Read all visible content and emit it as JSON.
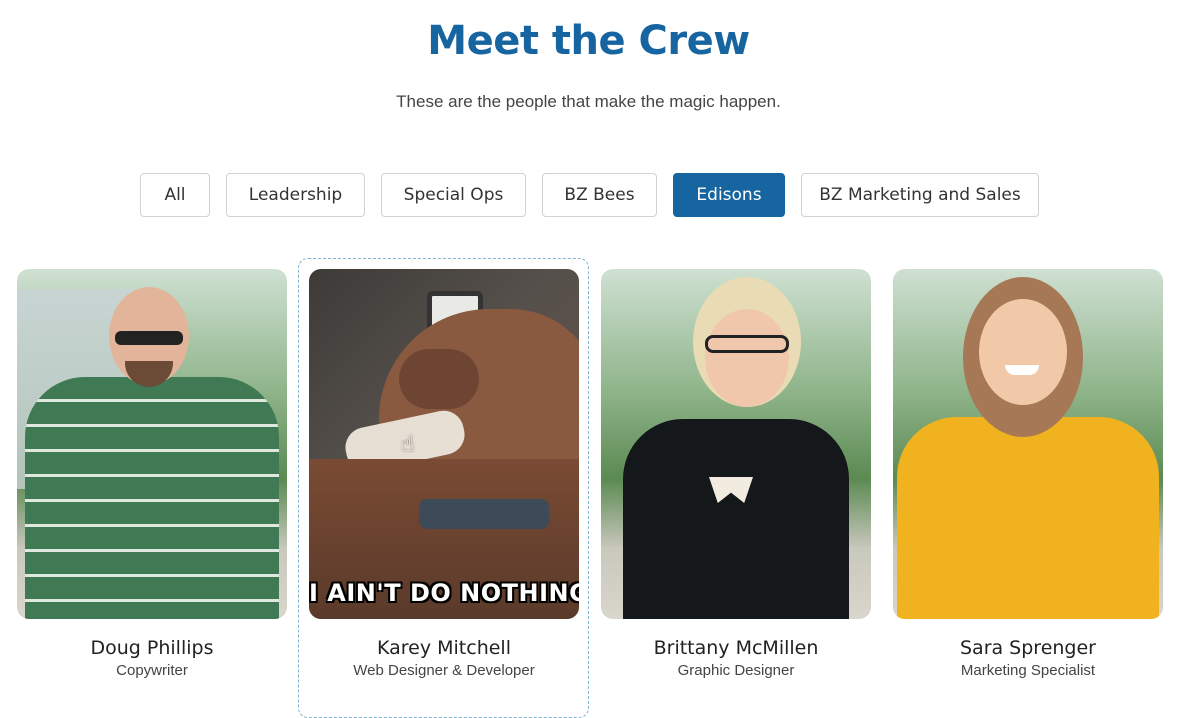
{
  "header": {
    "title": "Meet the Crew",
    "subtitle": "These are the people that make the magic happen."
  },
  "filters": [
    {
      "label": "All",
      "active": false
    },
    {
      "label": "Leadership",
      "active": false
    },
    {
      "label": "Special Ops",
      "active": false
    },
    {
      "label": "BZ Bees",
      "active": false
    },
    {
      "label": "Edisons",
      "active": true
    },
    {
      "label": "BZ Marketing and Sales",
      "active": false
    }
  ],
  "team": [
    {
      "name": "Doug Phillips",
      "role": "Copywriter",
      "photo": "portrait-photo"
    },
    {
      "name": "Karey Mitchell",
      "role": "Web Designer & Developer",
      "photo": "dog-gif",
      "photo_caption": "I AIN'T DO NOTHING"
    },
    {
      "name": "Brittany McMillen",
      "role": "Graphic Designer",
      "photo": "portrait-photo"
    },
    {
      "name": "Sara Sprenger",
      "role": "Marketing Specialist",
      "photo": "portrait-photo"
    }
  ],
  "colors": {
    "accent": "#1765a0",
    "border": "#cfd3d6"
  }
}
